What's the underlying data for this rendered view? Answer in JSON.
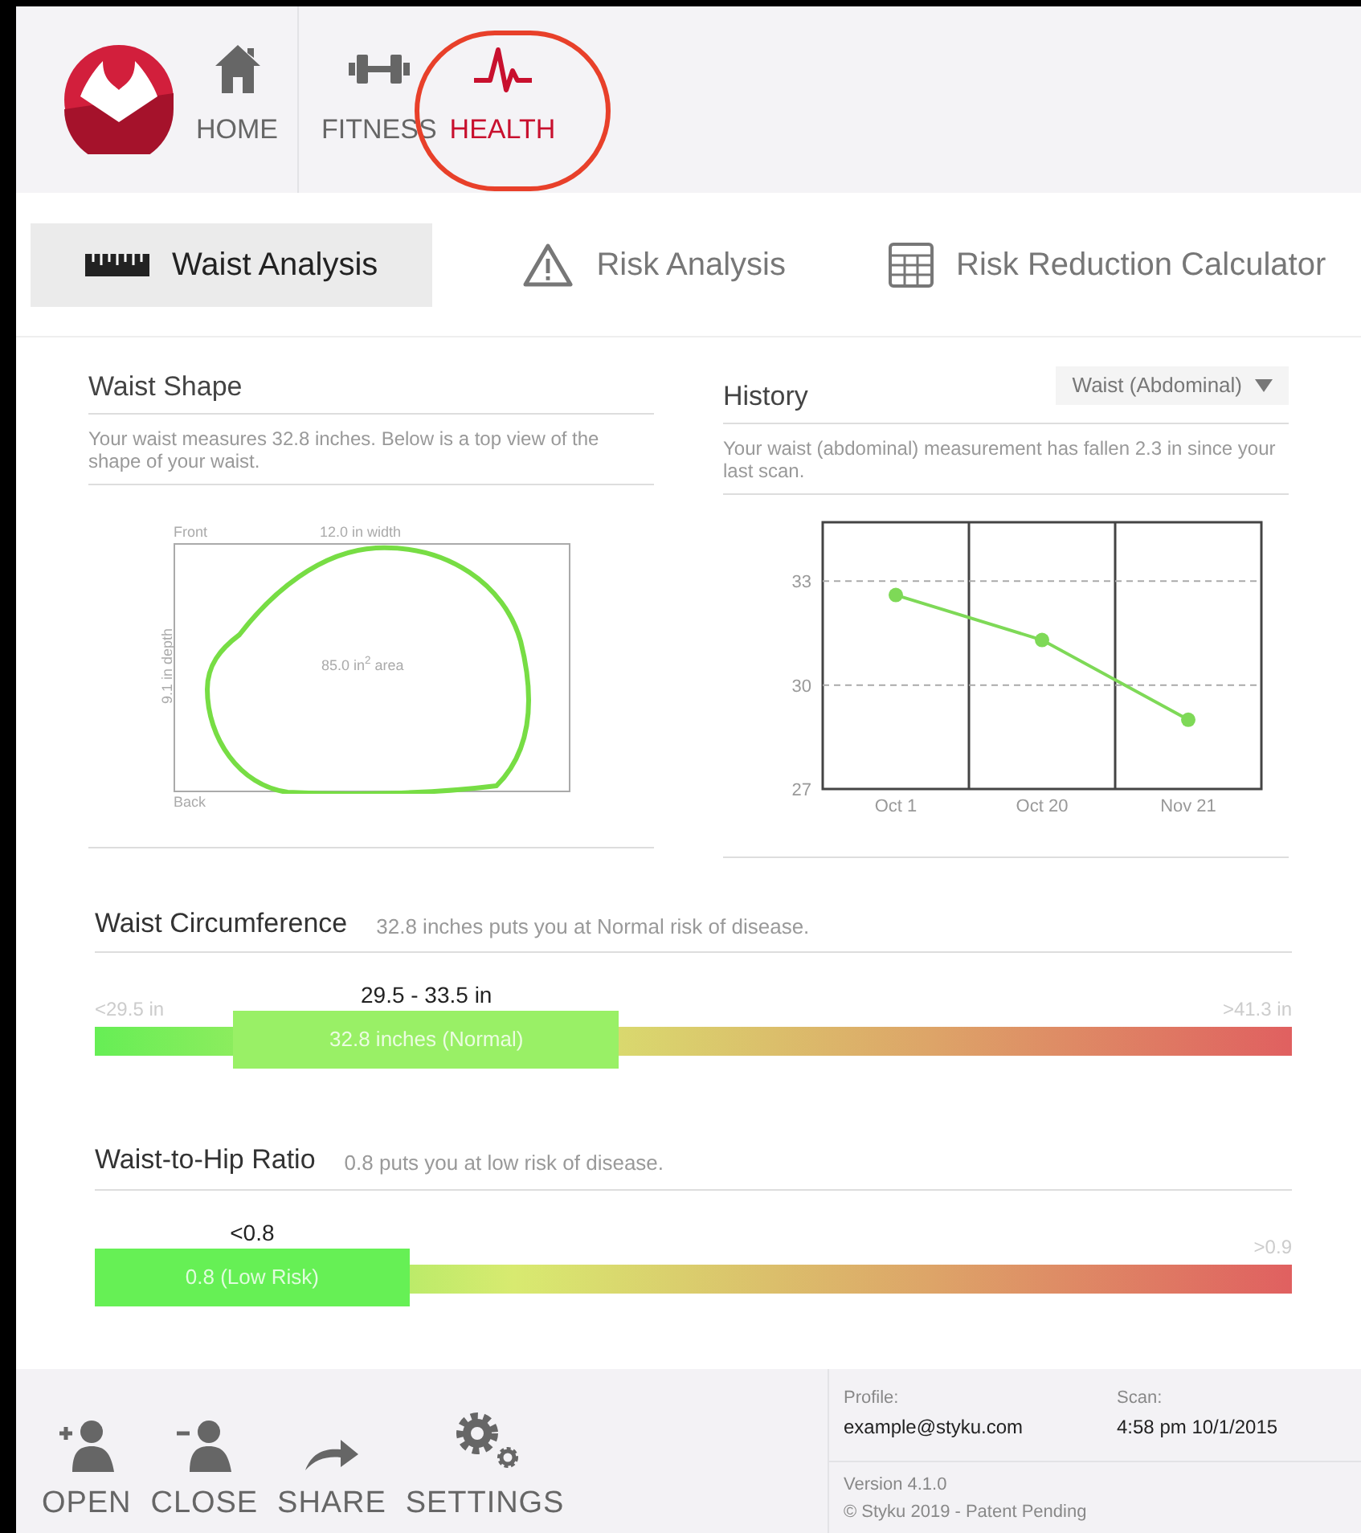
{
  "nav": [
    {
      "label": "HOME",
      "selected": false,
      "highlighted": false
    },
    {
      "label": "FITNESS",
      "selected": false,
      "highlighted": false
    },
    {
      "label": "HEALTH",
      "selected": true,
      "highlighted": true
    }
  ],
  "tabs": [
    {
      "label": "Waist Analysis",
      "selected": true
    },
    {
      "label": "Risk Analysis",
      "selected": false
    },
    {
      "label": "Risk Reduction Calculator",
      "selected": false
    }
  ],
  "waist_shape": {
    "title": "Waist Shape",
    "description": "Your waist measures 32.8 inches. Below is a top view of the shape of your waist.",
    "front": "Front",
    "width": "12.0 in width",
    "depth": "9.1 in depth",
    "area": "85.0 in$^{2}$ area",
    "back": "Back"
  },
  "history": {
    "title": "History",
    "dropdown": "Waist (Abdominal)",
    "description": "Your waist (abdominal) measurement has fallen 2.3 in since your last scan.",
    "chart_data": {
      "type": "line",
      "categories": [
        "Oct 1",
        "Oct 20",
        "Nov 21"
      ],
      "series": [
        {
          "color": "#7ed957",
          "marker": "circle",
          "values": [
            32.6,
            31.3,
            29.0
          ]
        }
      ],
      "ylim": [
        27,
        34.7
      ],
      "yticks": [
        27,
        30,
        33
      ]
    }
  },
  "gauges": [
    {
      "title": "Waist Circumference",
      "summary": "32.8 inches puts you at Normal risk of disease.",
      "range": "29.5 - 33.5 in",
      "min_label": "<29.5 in",
      "max_label": ">41.3 in",
      "marker": "32.8 inches (Normal)"
    },
    {
      "title": "Waist-to-Hip Ratio",
      "summary": "0.8 puts you at low risk of disease.",
      "range": "<0.8",
      "max_label": ">0.9",
      "marker": "0.8 (Low Risk)"
    }
  ],
  "toolbar": [
    {
      "label": "OPEN"
    },
    {
      "label": "CLOSE"
    },
    {
      "label": "SHARE"
    },
    {
      "label": "SETTINGS"
    }
  ],
  "info": {
    "profile_label": "Profile:",
    "profile": "example@styku.com",
    "scan_label": "Scan:",
    "scan": "4:58 pm 10/1/2015",
    "version": "Version 4.1.0",
    "copyright": "© Styku 2019 - Patent Pending"
  }
}
